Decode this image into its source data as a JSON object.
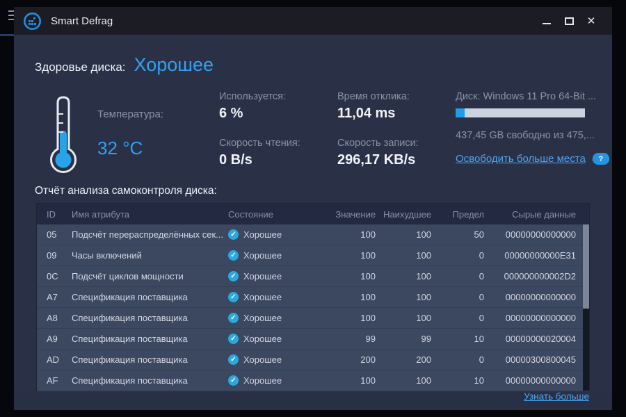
{
  "window": {
    "title": "Smart Defrag",
    "controls": {
      "close_glyph": "✕"
    }
  },
  "health": {
    "label": "Здоровье диска:",
    "value": "Хорошее"
  },
  "temperature": {
    "label": "Температура:",
    "value": "32 °C"
  },
  "stats": {
    "used": {
      "label": "Используется:",
      "value": "6 %"
    },
    "response": {
      "label": "Время отклика:",
      "value": "11,04 ms"
    },
    "read": {
      "label": "Скорость чтения:",
      "value": "0 B/s"
    },
    "write": {
      "label": "Скорость записи:",
      "value": "296,17 KB/s"
    }
  },
  "disk": {
    "label": "Диск: Windows 11 Pro 64-Bit ...",
    "usage_percent": 7,
    "free_text": "437,45 GB свободно из 475,...",
    "free_link": "Освободить больше места",
    "help_glyph": "?"
  },
  "report": {
    "title": "Отчёт анализа самоконтроля диска:",
    "columns": [
      "ID",
      "Имя атрибута",
      "Состояние",
      "Значение",
      "Наихудшее",
      "Предел",
      "Сырые данные"
    ],
    "check_glyph": "✓",
    "rows": [
      {
        "id": "05",
        "attribute": "Подсчёт перераспределённых сек...",
        "status": "Хорошее",
        "value": "100",
        "worst": "100",
        "threshold": "50",
        "raw": "00000000000000"
      },
      {
        "id": "09",
        "attribute": "Часы включений",
        "status": "Хорошее",
        "value": "100",
        "worst": "100",
        "threshold": "0",
        "raw": "00000000000E31"
      },
      {
        "id": "0C",
        "attribute": "Подсчёт циклов мощности",
        "status": "Хорошее",
        "value": "100",
        "worst": "100",
        "threshold": "0",
        "raw": "000000000002D2"
      },
      {
        "id": "A7",
        "attribute": "Спецификация поставщика",
        "status": "Хорошее",
        "value": "100",
        "worst": "100",
        "threshold": "0",
        "raw": "00000000000000"
      },
      {
        "id": "A8",
        "attribute": "Спецификация поставщика",
        "status": "Хорошее",
        "value": "100",
        "worst": "100",
        "threshold": "0",
        "raw": "00000000000000"
      },
      {
        "id": "A9",
        "attribute": "Спецификация поставщика",
        "status": "Хорошее",
        "value": "99",
        "worst": "99",
        "threshold": "10",
        "raw": "00000000020004"
      },
      {
        "id": "AD",
        "attribute": "Спецификация поставщика",
        "status": "Хорошее",
        "value": "200",
        "worst": "200",
        "threshold": "0",
        "raw": "00000300800045"
      },
      {
        "id": "AF",
        "attribute": "Спецификация поставщика",
        "status": "Хорошее",
        "value": "100",
        "worst": "100",
        "threshold": "10",
        "raw": "00000000000000"
      }
    ]
  },
  "footer": {
    "learn_more": "Узнать больше"
  },
  "colors": {
    "accent_blue": "#2da2f5",
    "link_blue": "#4da6f5",
    "check_blue": "#29a8e2",
    "progress_fill": "#1f9ded",
    "progress_track": "#ccd3e0",
    "window_bg": "#2a3147",
    "titlebar_bg": "#1c1d24",
    "table_row_bg": "#3c4760",
    "table_header_bg": "#222940"
  }
}
